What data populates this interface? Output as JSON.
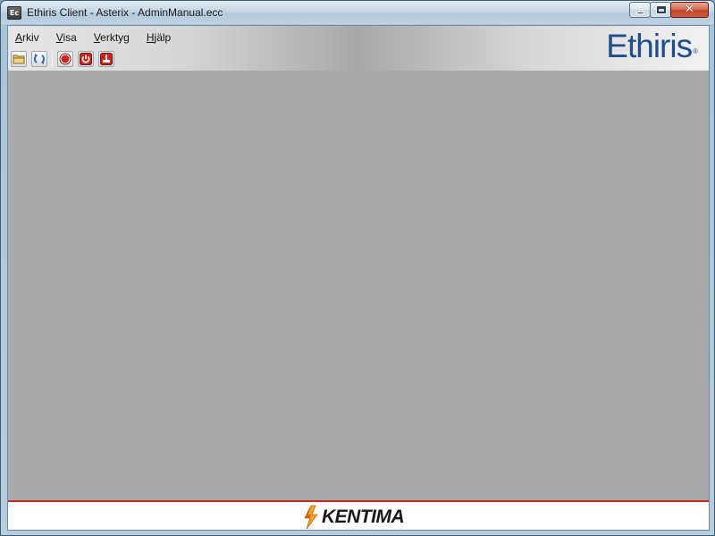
{
  "window": {
    "app_icon_text": "Ec",
    "title": "Ethiris Client - Asterix - AdminManual.ecc",
    "close_glyph": "✕"
  },
  "menu": {
    "items": [
      {
        "accel": "A",
        "rest": "rkiv"
      },
      {
        "accel": "V",
        "rest": "isa"
      },
      {
        "accel": "V",
        "rest": "erktyg"
      },
      {
        "accel": "H",
        "rest": "jälp"
      }
    ]
  },
  "toolbar": {
    "icons": [
      "open-folder-icon",
      "refresh-icon",
      "record-icon",
      "power-icon",
      "export-icon"
    ]
  },
  "branding": {
    "product_logo": "Ethiris",
    "product_logo_mark": "®",
    "vendor_logo": "KENTIMA"
  },
  "colors": {
    "workspace": "#aaaaaa",
    "footer_rule": "#c8271f",
    "ethiris_blue": "#1e4f8c",
    "record_red": "#c8271f"
  }
}
